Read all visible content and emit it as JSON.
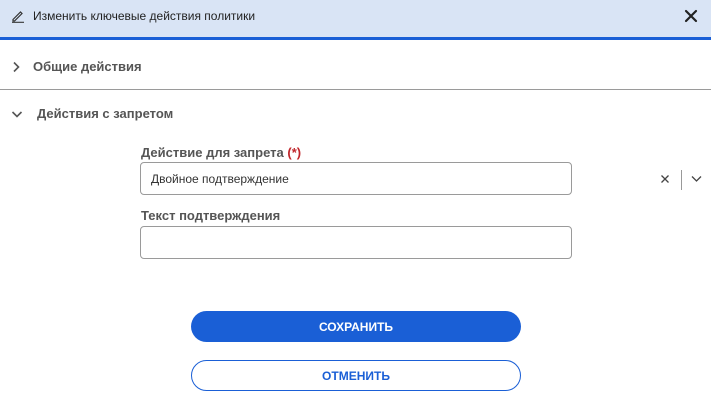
{
  "dialog": {
    "title": "Изменить ключевые действия политики",
    "icons": {
      "title_icon": "edit-pencil-icon",
      "close_icon": "close-icon"
    }
  },
  "sections": {
    "general": {
      "label": "Общие действия",
      "expanded": false
    },
    "forbidden": {
      "label": "Действия с запретом",
      "expanded": true
    }
  },
  "form": {
    "action_label": "Действие для запрета",
    "required_mark": "(*)",
    "action_value": "Двойное подтверждение",
    "confirm_text_label": "Текст подтверждения",
    "confirm_text_value": ""
  },
  "buttons": {
    "save": "СОХРАНИТЬ",
    "cancel": "ОТМЕНИТЬ"
  },
  "colors": {
    "accent": "#1a5fd6",
    "header_bg": "#d9e4f5",
    "required": "#c0262b"
  }
}
